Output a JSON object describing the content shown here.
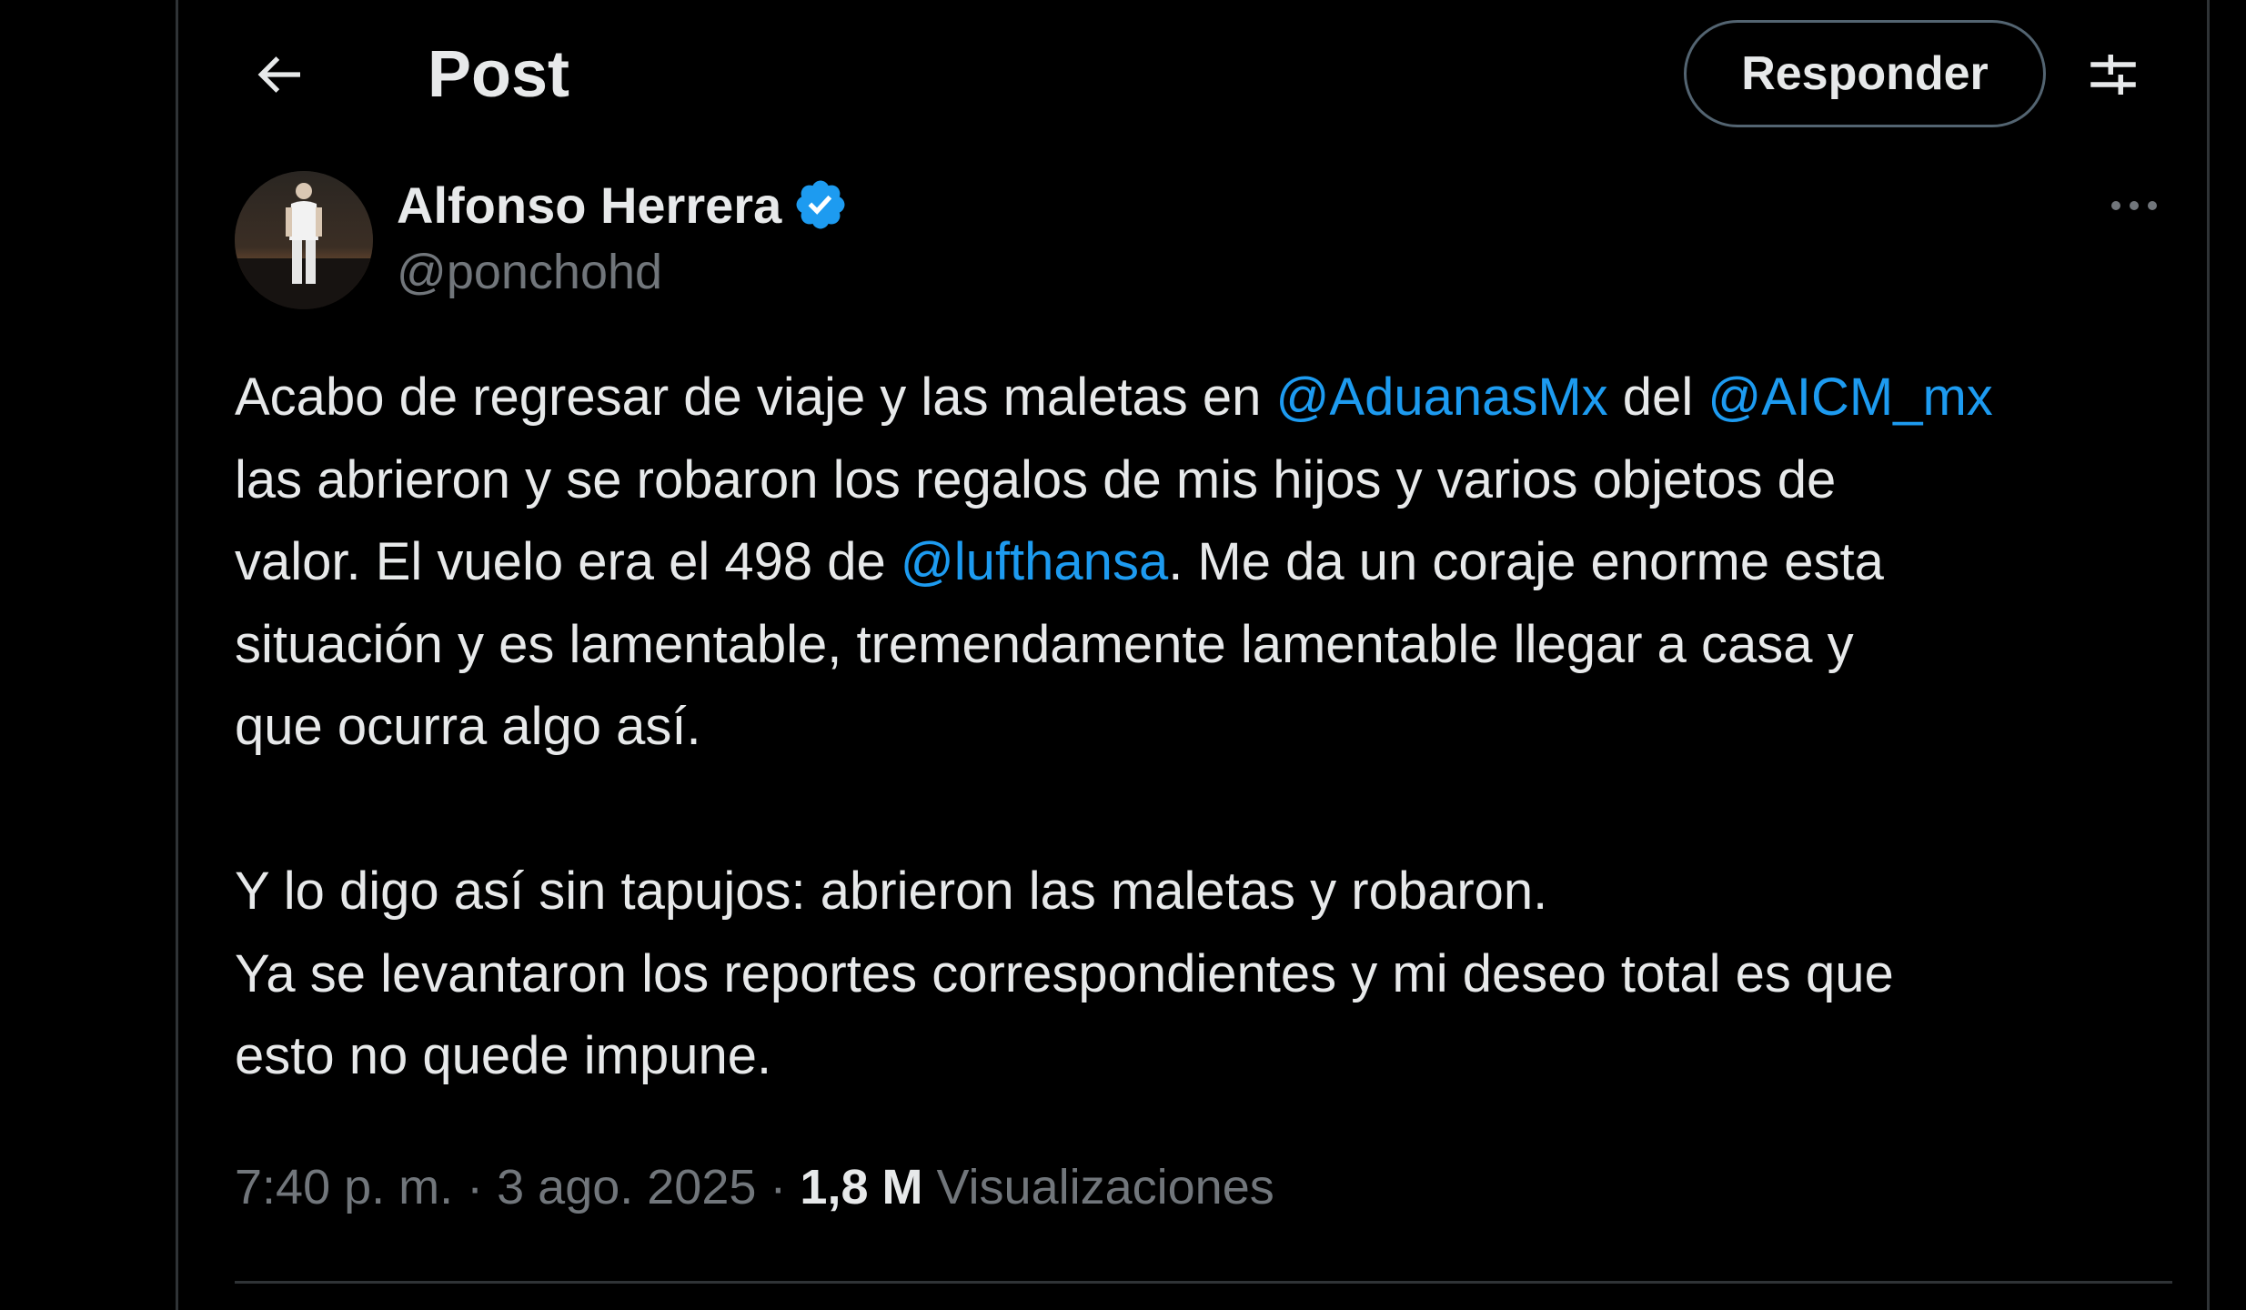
{
  "header": {
    "title": "Post",
    "reply_label": "Responder"
  },
  "author": {
    "name": "Alfonso Herrera",
    "handle": "@ponchohd",
    "verified": true
  },
  "tweet": {
    "segments": [
      {
        "text": "Acabo de regresar de viaje y las maletas en "
      },
      {
        "text": "@AduanasMx",
        "mention": true
      },
      {
        "text": " del "
      },
      {
        "text": "@AICM_mx",
        "mention": true
      },
      {
        "text": "\nlas abrieron y se robaron los regalos de mis hijos y varios objetos de\nvalor. El vuelo era el 498 de "
      },
      {
        "text": "@lufthansa",
        "mention": true
      },
      {
        "text": ". Me da un coraje enorme esta\nsituación y es lamentable, tremendamente lamentable llegar a casa y\nque ocurra algo así.\n\nY lo digo así sin tapujos: abrieron las maletas y robaron.\nYa se levantaron los reportes correspondientes y mi deseo total es que\nesto no quede impune."
      }
    ]
  },
  "meta": {
    "time": "7:40 p. m.",
    "separator": " · ",
    "date": "3 ago. 2025",
    "views_count": "1,8 M",
    "views_label": "Visualizaciones"
  },
  "colors": {
    "background": "#000000",
    "text_primary": "#e7e9ea",
    "text_secondary": "#71767b",
    "accent": "#1d9bf0",
    "border": "#2f3336"
  },
  "icons": {
    "back": "arrow-left-icon",
    "settings": "sliders-icon",
    "verified": "verified-badge-icon",
    "more": "more-horizontal-icon"
  }
}
